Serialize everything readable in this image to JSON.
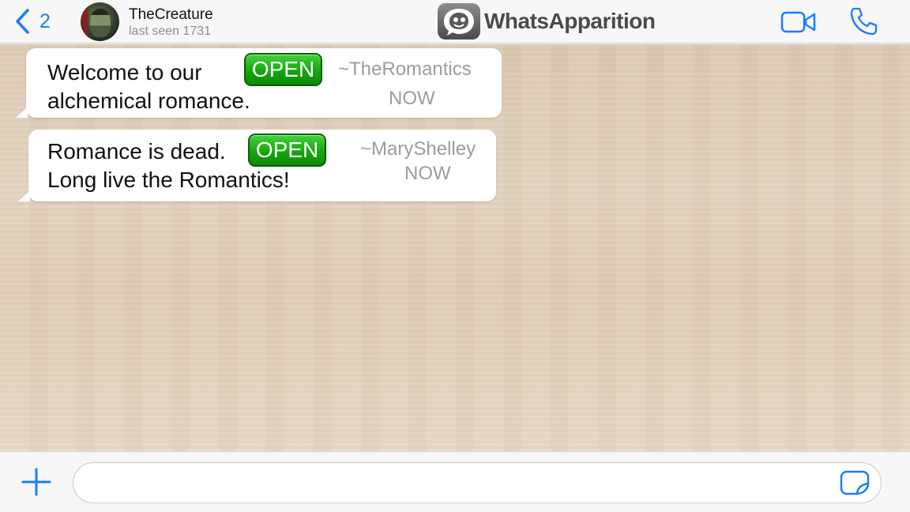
{
  "header": {
    "back_count": "2",
    "contact_name": "TheCreature",
    "contact_status": "last seen 1731",
    "app_title": "WhatsApparition"
  },
  "messages": [
    {
      "line1": "Welcome to our",
      "line2": "alchemical romance.",
      "button_label": "OPEN",
      "author": "~TheRomantics",
      "time": "NOW"
    },
    {
      "line1": "Romance is dead.",
      "line2": "Long live the Romantics!",
      "button_label": "OPEN",
      "author": "~MaryShelley",
      "time": "NOW"
    }
  ],
  "composer": {
    "value": "",
    "placeholder": ""
  },
  "colors": {
    "accent_blue": "#1b7ef5",
    "open_green": "#15a70f",
    "chat_background": "#e0cfb9"
  },
  "icons": [
    "chevron-left-icon",
    "avatar",
    "ghost-logo-icon",
    "video-camera-icon",
    "phone-icon",
    "plus-icon",
    "sticker-icon"
  ]
}
